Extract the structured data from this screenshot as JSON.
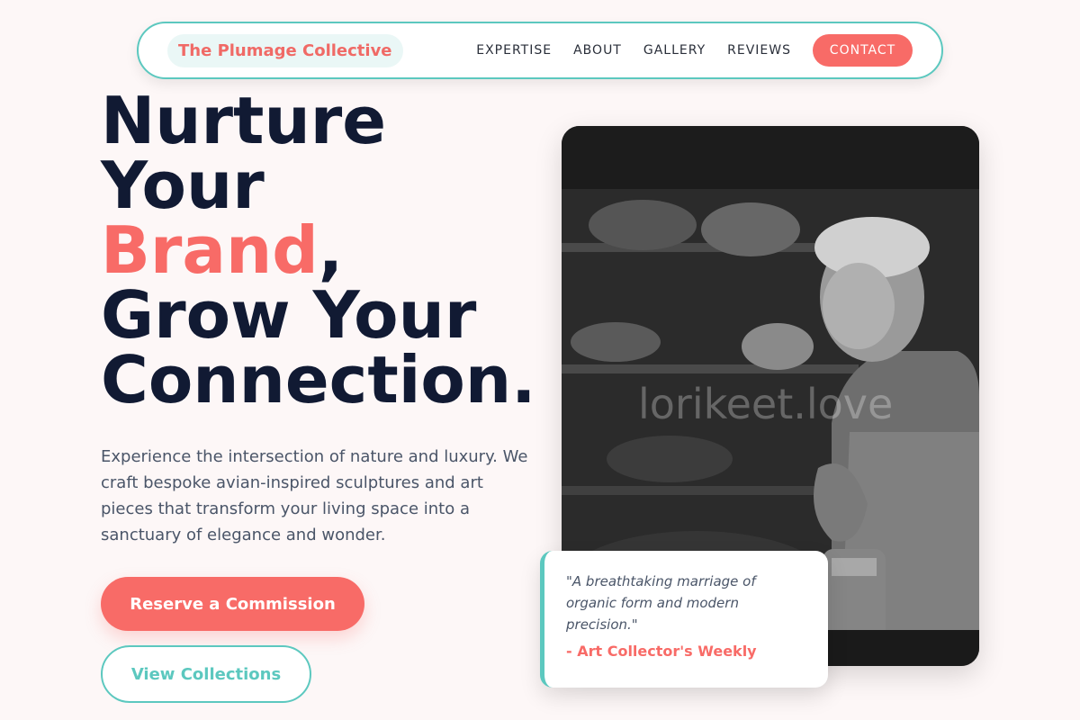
{
  "nav": {
    "brand": "The Plumage Collective",
    "links": [
      "EXPERTISE",
      "ABOUT",
      "GALLERY",
      "REVIEWS"
    ],
    "cta": "CONTACT"
  },
  "hero": {
    "title_line1": "Nurture",
    "title_line2": "Your",
    "title_accent": "Brand",
    "title_comma": ",",
    "title_line4": "Grow Your",
    "title_line5": "Connection.",
    "description": "Experience the intersection of nature and luxury. We craft bespoke avian-inspired sculptures and art pieces that transform your living space into a sanctuary of elegance and wonder.",
    "primary_button": "Reserve a Commission",
    "secondary_button": "View Collections"
  },
  "image": {
    "watermark": "lorikeet.love"
  },
  "testimonial": {
    "quote": "\"A breathtaking marriage of organic form and modern precision.\"",
    "source": "- Art Collector's Weekly"
  },
  "colors": {
    "accent": "#f86b67",
    "teal": "#5cc8bf",
    "heading": "#111a33",
    "background": "#fdf7f7"
  }
}
